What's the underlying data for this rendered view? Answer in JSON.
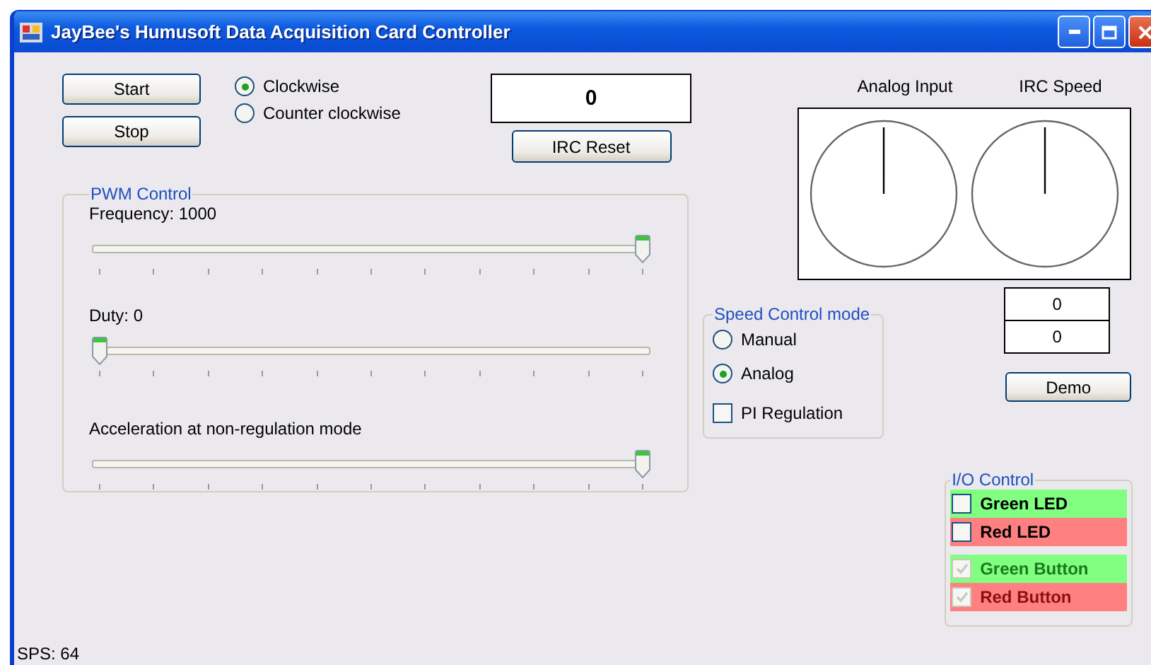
{
  "window": {
    "title": "JayBee's Humusoft Data Acquisition Card Controller"
  },
  "buttons": [
    {
      "label": "Start"
    },
    {
      "label": "Stop"
    }
  ],
  "direction": [
    {
      "label": "Clockwise",
      "selected": true
    },
    {
      "label": "Counter clockwise",
      "selected": false
    }
  ],
  "counter": {
    "value": "0"
  },
  "irc_reset": {
    "label": "IRC Reset"
  },
  "pwm_control": {
    "title": "PWM Control",
    "sliders": [
      {
        "label": "Frequency: 1000",
        "level": 1
      },
      {
        "label": "Duty: 0",
        "level": 0
      },
      {
        "label": "Acceleration at non-regulation mode",
        "level": 1
      }
    ]
  },
  "gauges": [
    {
      "label": "Analog Input"
    },
    {
      "label": "IRC Speed"
    }
  ],
  "readouts": [
    "0",
    "0"
  ],
  "demo": {
    "label": "Demo"
  },
  "speed_control_mode": {
    "title": "Speed Control mode",
    "modes": [
      {
        "label": "Manual",
        "selected": false
      },
      {
        "label": "Analog",
        "selected": true
      }
    ],
    "pi_regulation": {
      "label": "PI Regulation",
      "checked": false
    }
  },
  "io_control": {
    "title": "I/O Control",
    "items": [
      {
        "label": "Green LED",
        "color": "#80ff80",
        "checked": false,
        "disabled": false
      },
      {
        "label": "Red LED",
        "color": "#ff8080",
        "checked": false,
        "disabled": false
      },
      {
        "label": "Green Button",
        "color": "#80ff80",
        "checked": true,
        "disabled": true
      },
      {
        "label": "Red Button",
        "color": "#ff8080",
        "checked": true,
        "disabled": true
      }
    ]
  },
  "status": {
    "text": "SPS: 64"
  }
}
